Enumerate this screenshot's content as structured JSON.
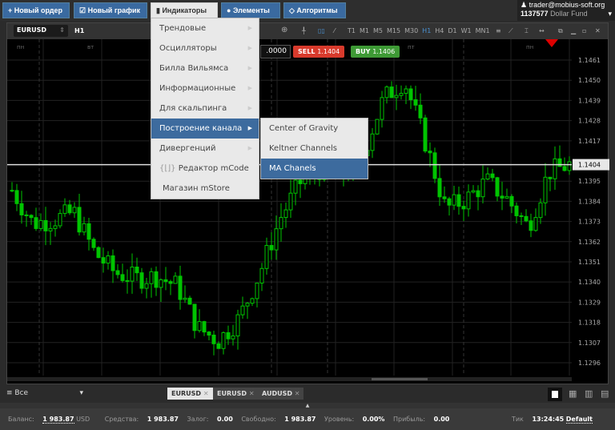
{
  "toolbar": {
    "new_order": "+ Новый ордер",
    "new_chart": "Новый график",
    "indicators": "Индикаторы",
    "elements": "Элементы",
    "algorithms": "Алгоритмы"
  },
  "user": {
    "email": "trader@mobius-soft.org",
    "account": "1137577",
    "fund": "Dollar Fund"
  },
  "chart_window": {
    "symbol": "EURUSD",
    "timeframe": "H1",
    "lot": ".0000",
    "sell_label": "SELL",
    "sell_price": "1.1404",
    "buy_label": "BUY",
    "buy_price": "1.1406",
    "timeframes": [
      "T1",
      "M1",
      "M5",
      "M15",
      "M30",
      "H1",
      "H4",
      "D1",
      "W1",
      "MN1"
    ],
    "active_timeframe": "H1"
  },
  "indicators_menu": {
    "items": [
      {
        "label": "Трендовые"
      },
      {
        "label": "Осцилляторы"
      },
      {
        "label": "Билла Вильямса"
      },
      {
        "label": "Информационные"
      },
      {
        "label": "Для скальпинга"
      },
      {
        "label": "Построение канала",
        "selected": true
      },
      {
        "label": "Дивергенций"
      },
      {
        "label": "Редактор mCode"
      },
      {
        "label": "Магазин mStore"
      }
    ]
  },
  "channel_submenu": {
    "items": [
      {
        "label": "Center of Gravity"
      },
      {
        "label": "Keltner Channels"
      },
      {
        "label": "MA Chanels",
        "selected": true
      }
    ]
  },
  "chart_data": {
    "type": "candlestick",
    "symbol": "EURUSD",
    "timeframe": "H1",
    "current_price": 1.1404,
    "y_ticks": [
      "1.1461",
      "1.1450",
      "1.1439",
      "1.1428",
      "1.1417",
      "1.1404",
      "1.1395",
      "1.1384",
      "1.1373",
      "1.1362",
      "1.1351",
      "1.1340",
      "1.1329",
      "1.1318",
      "1.1307",
      "1.1296"
    ],
    "ylim": [
      1.1289,
      1.1468
    ],
    "x_ticks": [
      "29 окт. 22:00",
      "30 окт. 10:00",
      "30 окт. 22:00",
      "31 окт. 10:00",
      "31 окт. 22:00",
      "01 нояб. 10:00",
      "01 нояб. 22:00",
      "02 нояб. 10:00",
      "02 нояб. 22:00",
      "05 нояб. 11:00"
    ],
    "day_labels": [
      "пн",
      "вт",
      "пт",
      "пн"
    ],
    "close_path": [
      1.139,
      1.1372,
      1.1374,
      1.1378,
      1.1356,
      1.1345,
      1.1342,
      1.1343,
      1.1338,
      1.1315,
      1.1308,
      1.132,
      1.1345,
      1.1375,
      1.1395,
      1.1402,
      1.1398,
      1.141,
      1.144,
      1.145,
      1.1417,
      1.138,
      1.1385,
      1.1395,
      1.1385,
      1.137,
      1.14,
      1.1404
    ],
    "candle_color": "#00c400"
  },
  "bottom": {
    "filter": "Все",
    "tabs": [
      "EURUSD",
      "EURUSD",
      "AUDUSD"
    ]
  },
  "status": {
    "balance_label": "Баланс:",
    "balance": "1 983.87",
    "currency": "USD",
    "equity_label": "Средства:",
    "equity": "1 983.87",
    "margin_label": "Залог:",
    "margin": "0.00",
    "free_label": "Свободно:",
    "free": "1 983.87",
    "level_label": "Уровень:",
    "level": "0.00%",
    "profit_label": "Прибыль:",
    "profit": "0.00",
    "tick_label": "Тик",
    "time": "13:24:45",
    "profile": "Default"
  }
}
